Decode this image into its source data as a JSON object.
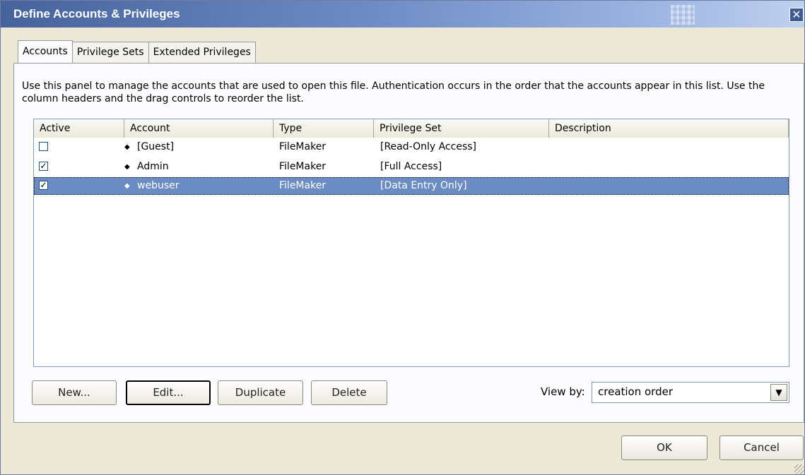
{
  "window": {
    "title": "Define Accounts & Privileges",
    "close_glyph": "✕"
  },
  "tabs": [
    {
      "label": "Accounts",
      "active": true
    },
    {
      "label": "Privilege Sets",
      "active": false
    },
    {
      "label": "Extended Privileges",
      "active": false
    }
  ],
  "description": "Use this panel to manage the accounts that are used to open this file. Authentication occurs in the order that the accounts appear in this list. Use the column headers and the drag controls to reorder the list.",
  "table": {
    "columns": [
      "Active",
      "Account",
      "Type",
      "Privilege Set",
      "Description"
    ],
    "drag_glyph": "◆",
    "rows": [
      {
        "active": false,
        "account": "[Guest]",
        "type": "FileMaker",
        "privilege_set": "[Read-Only Access]",
        "description": "",
        "selected": false
      },
      {
        "active": true,
        "account": "Admin",
        "type": "FileMaker",
        "privilege_set": "[Full Access]",
        "description": "",
        "selected": false
      },
      {
        "active": true,
        "account": "webuser",
        "type": "FileMaker",
        "privilege_set": "[Data Entry Only]",
        "description": "",
        "selected": true
      }
    ]
  },
  "buttons": {
    "new": "New...",
    "edit": "Edit...",
    "duplicate": "Duplicate",
    "delete": "Delete",
    "ok": "OK",
    "cancel": "Cancel"
  },
  "view_by": {
    "label": "View by:",
    "value": "creation order",
    "arrow_glyph": "▼"
  },
  "colors": {
    "selection": "#6b8bc3",
    "titlebar": "#46639b",
    "dialog_bg": "#ece9d8"
  }
}
